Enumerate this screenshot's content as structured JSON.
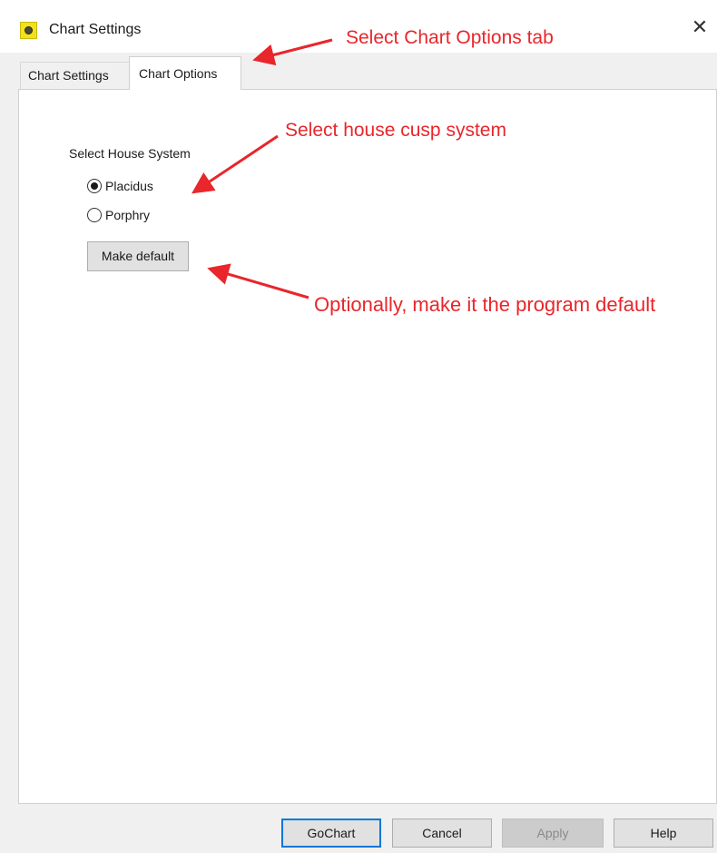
{
  "window": {
    "title": "Chart Settings",
    "close_symbol": "✕"
  },
  "tabs": [
    {
      "label": "Chart Settings",
      "active": false
    },
    {
      "label": "Chart Options",
      "active": true
    }
  ],
  "house_system": {
    "label": "Select House System",
    "options": [
      {
        "label": "Placidus",
        "selected": true
      },
      {
        "label": "Porphry",
        "selected": false
      }
    ],
    "make_default_label": "Make default"
  },
  "footer": {
    "gochart_label": "GoChart",
    "cancel_label": "Cancel",
    "apply_label": "Apply",
    "help_label": "Help"
  },
  "annotations": {
    "select_tab": "Select Chart Options tab",
    "select_cusp": "Select house cusp system",
    "make_default": "Optionally, make it the program default",
    "color": "#e8262b"
  },
  "icons": {
    "app_icon": "app-icon",
    "close_icon": "close-icon"
  },
  "colors": {
    "focus_border": "#0078d7",
    "annotation": "#e8262b"
  }
}
